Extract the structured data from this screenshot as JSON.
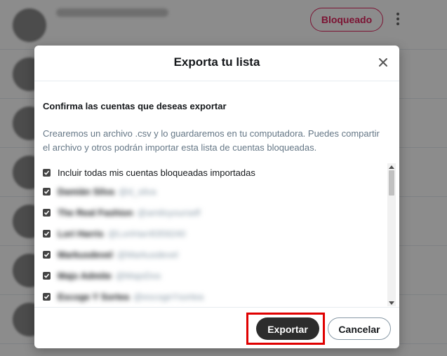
{
  "background": {
    "blocked_button_label": "Bloqueado",
    "rows": 8
  },
  "modal": {
    "title": "Exporta tu lista",
    "section_title": "Confirma las cuentas que deseas exportar",
    "description": "Crearemos un archivo .csv y lo guardaremos en tu computadora. Puedes compartir el archivo y otros podrán importar esta lista de cuentas bloqueadas.",
    "include_all_label": "Incluir todas mis cuentas bloqueadas importadas",
    "accounts": [
      {
        "name": "Damián Silva",
        "handle": "@d_silva",
        "checked": true
      },
      {
        "name": "The Real Fashion",
        "handle": "@amiloyourself",
        "checked": true
      },
      {
        "name": "Lori Harris",
        "handle": "@LoriHarr8359240",
        "checked": true
      },
      {
        "name": "Markusdevel",
        "handle": "@Markusdevel",
        "checked": true
      },
      {
        "name": "Majo Admite",
        "handle": "@MajoDos",
        "checked": true
      },
      {
        "name": "Escoge Y Sortea",
        "handle": "@escogeYsortea",
        "checked": true
      }
    ],
    "export_label": "Exportar",
    "cancel_label": "Cancelar"
  },
  "colors": {
    "blocked_accent": "#e0245e",
    "export_button": "#2d2d2d",
    "highlight_box": "#e00000",
    "secondary_text": "#657786"
  }
}
